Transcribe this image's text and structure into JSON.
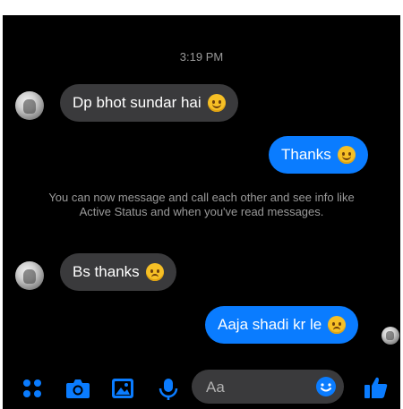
{
  "conversation": {
    "timestamp": "3:19 PM",
    "messages": [
      {
        "from": "them",
        "text": "Dp bhot sundar hai",
        "emoji": "smiling-face-emoji"
      },
      {
        "from": "me",
        "text": "Thanks",
        "emoji": "smiling-face-emoji"
      },
      {
        "from": "them",
        "text": "Bs thanks",
        "emoji": "worried-face-emoji"
      },
      {
        "from": "me",
        "text": "Aaja shadi kr le",
        "emoji": "worried-face-emoji"
      }
    ],
    "notice": "You can now message and call each other and see info like Active Status and when you've read messages."
  },
  "composer": {
    "placeholder": "Aa",
    "icons": [
      "menu-dots-icon",
      "camera-icon",
      "gallery-icon",
      "microphone-icon",
      "emoji-icon",
      "thumbs-up-icon"
    ]
  },
  "colors": {
    "background": "#000000",
    "incoming_bubble": "#3a3a3c",
    "outgoing_bubble": "#0a7cff",
    "accent": "#0a7cff",
    "muted_text": "#9a9a9a"
  }
}
